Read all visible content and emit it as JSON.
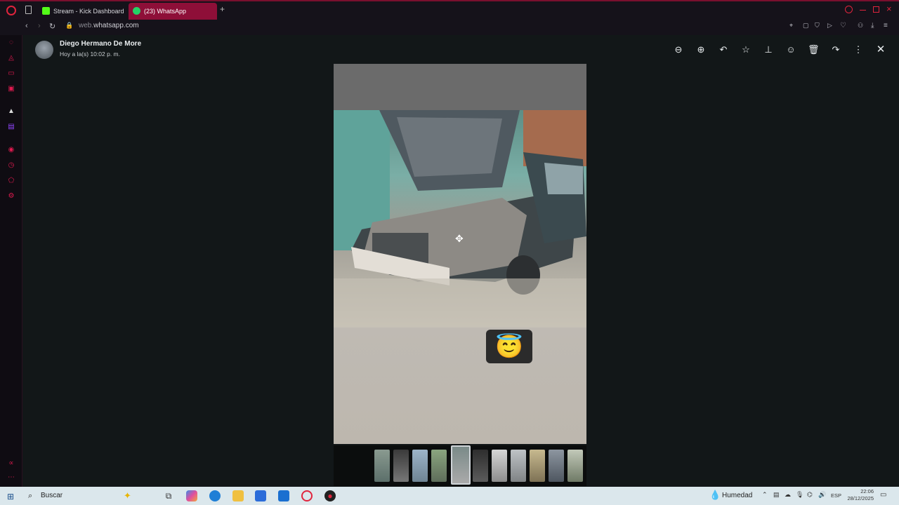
{
  "browser": {
    "tabs": [
      {
        "label": "Stream - Kick Dashboard",
        "favicon_color": "#53fc18"
      },
      {
        "label": "(23) WhatsApp",
        "favicon_color": "#25d366"
      }
    ],
    "new_tab_label": "+",
    "url": {
      "prefix": "web.",
      "domain": "whatsapp.com"
    }
  },
  "viewer": {
    "contact_name": "Diego Hermano De More",
    "timestamp": "Hoy a la(s) 10:02 p. m.",
    "toolbar": [
      "zoom-out-icon",
      "zoom-in-icon",
      "reply-icon",
      "star-icon",
      "pin-icon",
      "emoji-icon",
      "delete-icon",
      "forward-icon",
      "more-icon",
      "close-icon"
    ],
    "reaction_emoji": "😇",
    "thumbnail_count": 11,
    "active_thumbnail": 4
  },
  "taskbar": {
    "search_label": "Buscar",
    "weather_label": "Humedad",
    "language": "ESP",
    "time": "22:06",
    "date": "28/12/2025"
  }
}
